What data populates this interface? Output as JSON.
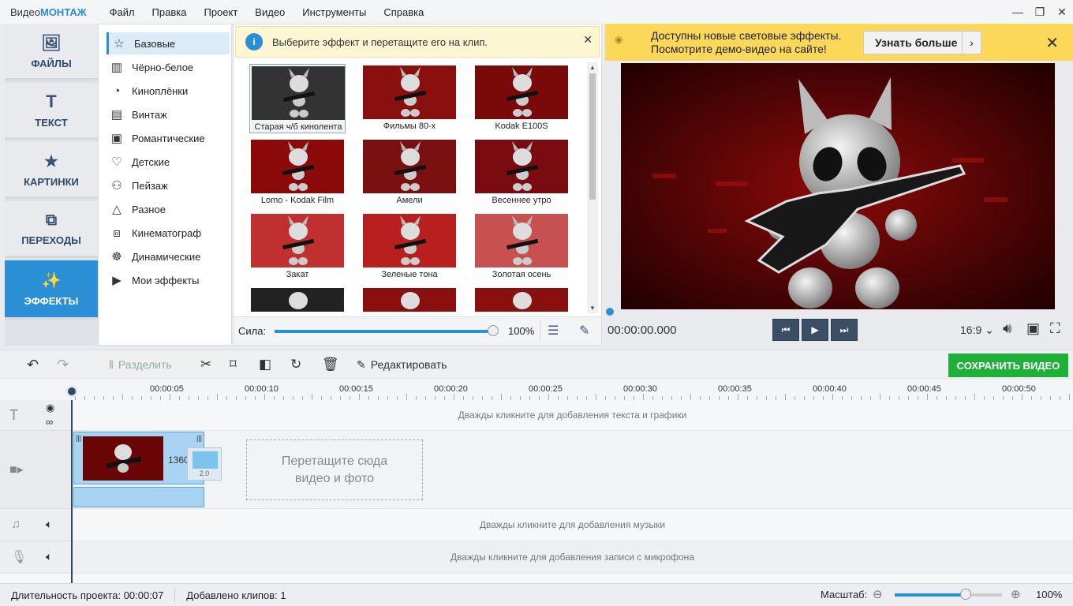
{
  "app": {
    "logo_plain": "Видео",
    "logo_bold": "МОНТАЖ"
  },
  "menu": [
    "Файл",
    "Правка",
    "Проект",
    "Видео",
    "Инструменты",
    "Справка"
  ],
  "nav": [
    {
      "label": "ФАЙЛЫ",
      "icon": "image-icon"
    },
    {
      "label": "ТЕКСТ",
      "icon": "text-icon"
    },
    {
      "label": "КАРТИНКИ",
      "icon": "star-icon"
    },
    {
      "label": "ПЕРЕХОДЫ",
      "icon": "transitions-icon"
    },
    {
      "label": "ЭФФЕКТЫ",
      "icon": "magic-wand-icon"
    }
  ],
  "categories": [
    "Базовые",
    "Чёрно-белое",
    "Киноплёнки",
    "Винтаж",
    "Романтические",
    "Детские",
    "Пейзаж",
    "Разное",
    "Кинематограф",
    "Динамические",
    "Мои эффекты"
  ],
  "info": {
    "text": "Выберите эффект и перетащите его на клип."
  },
  "effects": [
    "Старая ч/б кинолента",
    "Фильмы 80-х",
    "Kodak E100S",
    "Lomo - Kodak Film",
    "Амели",
    "Весеннее утро",
    "Закат",
    "Зеленые тона",
    "Золотая осень"
  ],
  "strength": {
    "label": "Сила:",
    "value_text": "100%",
    "value": 1.0
  },
  "banner": {
    "line1": "Доступны новые световые эффекты.",
    "line2": "Посмотрите демо-видео на сайте!",
    "button": "Узнать больше"
  },
  "player": {
    "time": "00:00:00.000",
    "aspect": "16:9"
  },
  "toolbar": {
    "split": "Разделить",
    "edit": "Редактировать",
    "save": "СОХРАНИТЬ ВИДЕО"
  },
  "ruler": [
    "00:00:05",
    "00:00:10",
    "00:00:15",
    "00:00:20",
    "00:00:25",
    "00:00:30",
    "00:00:35",
    "00:00:40",
    "00:00:45",
    "00:00:50"
  ],
  "tracks": {
    "text_hint": "Дважды кликните для добавления текста и графики",
    "drop_line1": "Перетащите сюда",
    "drop_line2": "видео и фото",
    "clip_label": "1360",
    "transition_label": "2.0",
    "music_hint": "Дважды кликните для добавления музыки",
    "mic_hint": "Дважды кликните для добавления записи с микрофона"
  },
  "status": {
    "duration": "Длительность проекта:  00:00:07",
    "clips": "Добавлено клипов: 1",
    "scale_label": "Масштаб:",
    "scale_value": "100%"
  },
  "colors": {
    "accent": "#2b8fd6",
    "save": "#1fb03a",
    "banner": "#fbd85a"
  }
}
